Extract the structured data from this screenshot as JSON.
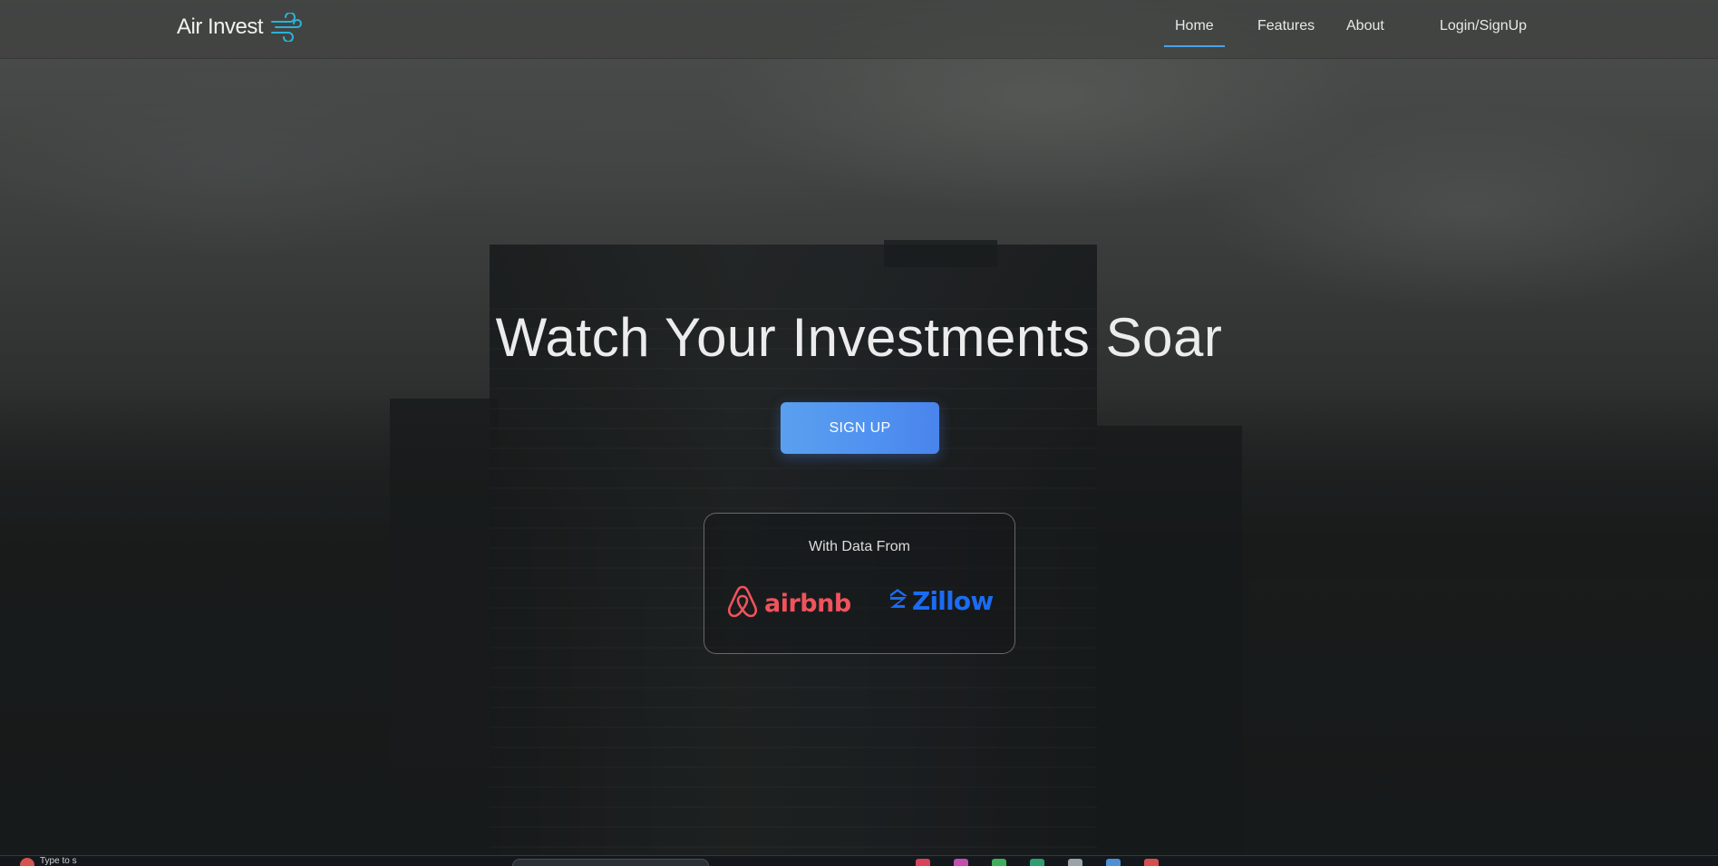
{
  "brand": {
    "name": "Air Invest",
    "icon": "wind-icon",
    "icon_color": "#2ab3d6"
  },
  "nav": {
    "items": [
      {
        "label": "Home",
        "active": true
      },
      {
        "label": "Features",
        "active": false
      },
      {
        "label": "About",
        "active": false
      },
      {
        "label": "Login/SignUp",
        "active": false
      }
    ],
    "active_underline_color": "#4aa3e8"
  },
  "hero": {
    "title": "Watch Your Investments Soar",
    "signup_label": "SIGN UP",
    "button_color": "#4f91f0"
  },
  "data_sources": {
    "label": "With Data From",
    "logos": [
      {
        "name": "airbnb",
        "icon": "airbnb-logo-icon",
        "color": "#f0535c"
      },
      {
        "name": "Zillow",
        "icon": "zillow-logo-icon",
        "color": "#1b6cf2"
      }
    ]
  },
  "taskbar": {
    "search_text": "Type to s"
  }
}
